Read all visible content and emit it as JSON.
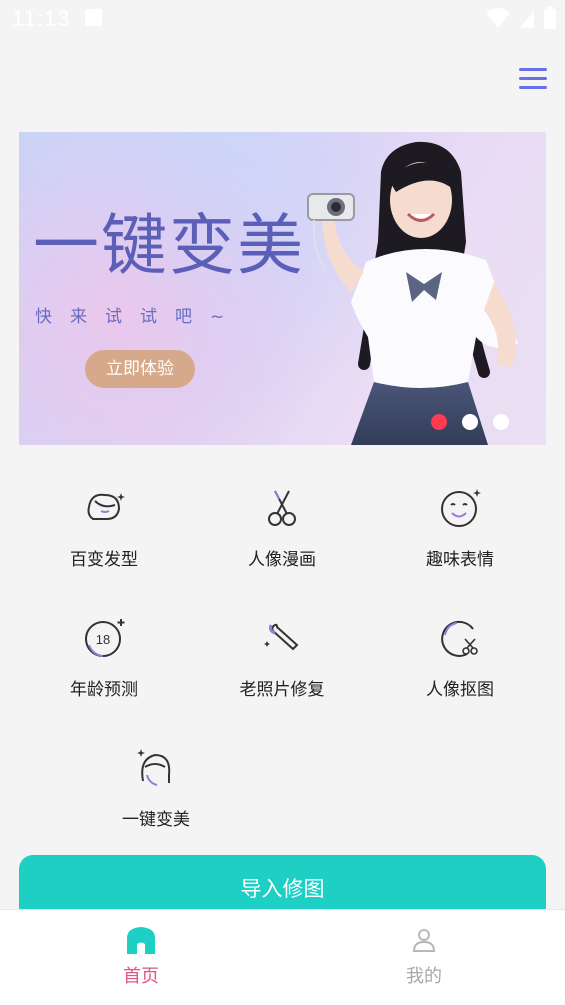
{
  "status_bar": {
    "time": "11:13"
  },
  "banner": {
    "title": "一键变美",
    "subtitle": "快来试试吧~",
    "cta_label": "立即体验",
    "active_slide": 1,
    "slide_count": 3
  },
  "tools": [
    {
      "label": "百变发型",
      "icon": "hair-icon"
    },
    {
      "label": "人像漫画",
      "icon": "scissors-icon"
    },
    {
      "label": "趣味表情",
      "icon": "face-icon"
    },
    {
      "label": "年龄预测",
      "icon": "age-18-icon"
    },
    {
      "label": "老照片修复",
      "icon": "brush-icon"
    },
    {
      "label": "人像抠图",
      "icon": "cutout-icon"
    },
    {
      "label": "一键变美",
      "icon": "beauty-icon"
    }
  ],
  "import_button": {
    "label": "导入修图"
  },
  "tabbar": {
    "home_label": "首页",
    "mine_label": "我的"
  },
  "colors": {
    "accent": "#1ecfc4",
    "menu": "#6a6fe8",
    "tab_active": "#e2557a",
    "dot_active": "#ff3b4f",
    "cta": "#d6a98a"
  }
}
